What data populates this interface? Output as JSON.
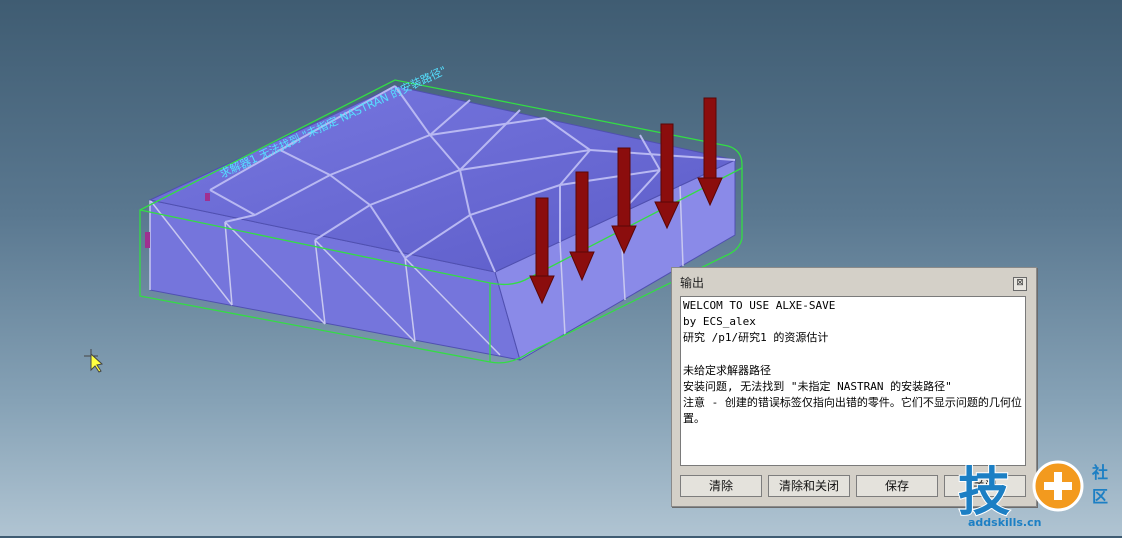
{
  "model": {
    "annotation_text": "求解器1 无法找到 \"未指定 NASTRAN 的安装路径\"",
    "load_arrow_color": "#8b0d0d",
    "mesh_color": "#6f6fdc",
    "edge_color": "#33dd44"
  },
  "output_dialog": {
    "title": "输出",
    "close_label": "⊠",
    "lines": [
      "WELCOM TO USE ALXE-SAVE",
      "by ECS_alex",
      "研究 /p1/研究1 的资源估计",
      "",
      "未给定求解器路径",
      "安装问题, 无法找到 \"未指定 NASTRAN 的安装路径\"",
      "注意 - 创建的错误标签仅指向出错的零件。它们不显示问题的几何位置。"
    ],
    "buttons": {
      "clear": "清除",
      "clear_close": "清除和关闭",
      "save": "保存",
      "close": "关闭"
    }
  },
  "watermark": {
    "logo_char": "技",
    "badge_top": "社",
    "badge_bottom": "区",
    "url": "addskills.cn"
  }
}
